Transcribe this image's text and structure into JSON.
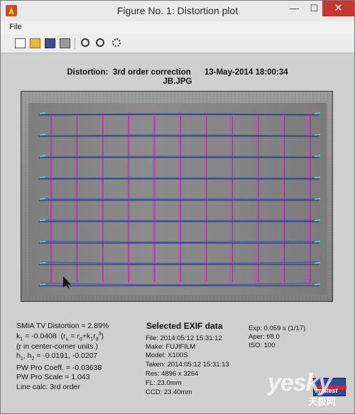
{
  "window": {
    "title": "Figure No. 1: Distortion plot",
    "minimize_glyph": "—",
    "maximize_glyph": "☐",
    "close_glyph": "✕"
  },
  "menu": {
    "file_label": "File"
  },
  "toolbar": {
    "icons": [
      "new-icon",
      "open-icon",
      "save-icon",
      "print-icon",
      "zoom-in-icon",
      "zoom-out-icon",
      "rotate-icon"
    ]
  },
  "figure": {
    "title_line1": "Distortion:  3rd order correction      13-May-2014 18:00:34",
    "title_line2": "JB.JPG"
  },
  "plot": {
    "vertical_line_count": 11,
    "horizontal_line_count": 9,
    "colors": {
      "vertical": "#e040c8",
      "horizontal": "#3a55e0",
      "edge_marks": "#4fe0e0",
      "dark_lines": "#1a1f4a"
    }
  },
  "results": {
    "smia": "SMIA TV Distortion = 2.89%",
    "k_line": "k1 = -0.0408  (ru = rd+k1rd3)",
    "note": "(r in center-corner units.)",
    "h_line": "h1, h2 = -0.0191, -0.0207",
    "pw_coeff": "PW Pro Coeff. = -0.03638",
    "pw_scale": "PW Pro Scale = 1.043",
    "line_calc": "Line calc: 3rd order"
  },
  "exif": {
    "title": "Selected EXIF data",
    "file": "File:  2014:05:12 15:31:12",
    "make": "Make:  FUJIFILM",
    "model": "Model: X100S",
    "taken": "Taken: 2014:05:12 15:31:13",
    "res": "Res:    4896 x 3264",
    "fl": "FL:  23.0mm",
    "ccd": "CCD:   23.40mm",
    "exp": "Exp:   0.059 s  (1/17)",
    "aper": "Aper:  f/8.0",
    "iso": "ISO:    100"
  },
  "branding": {
    "watermark": "yesky",
    "watermark_sub": "天极网",
    "logo_text": "Imatest"
  }
}
